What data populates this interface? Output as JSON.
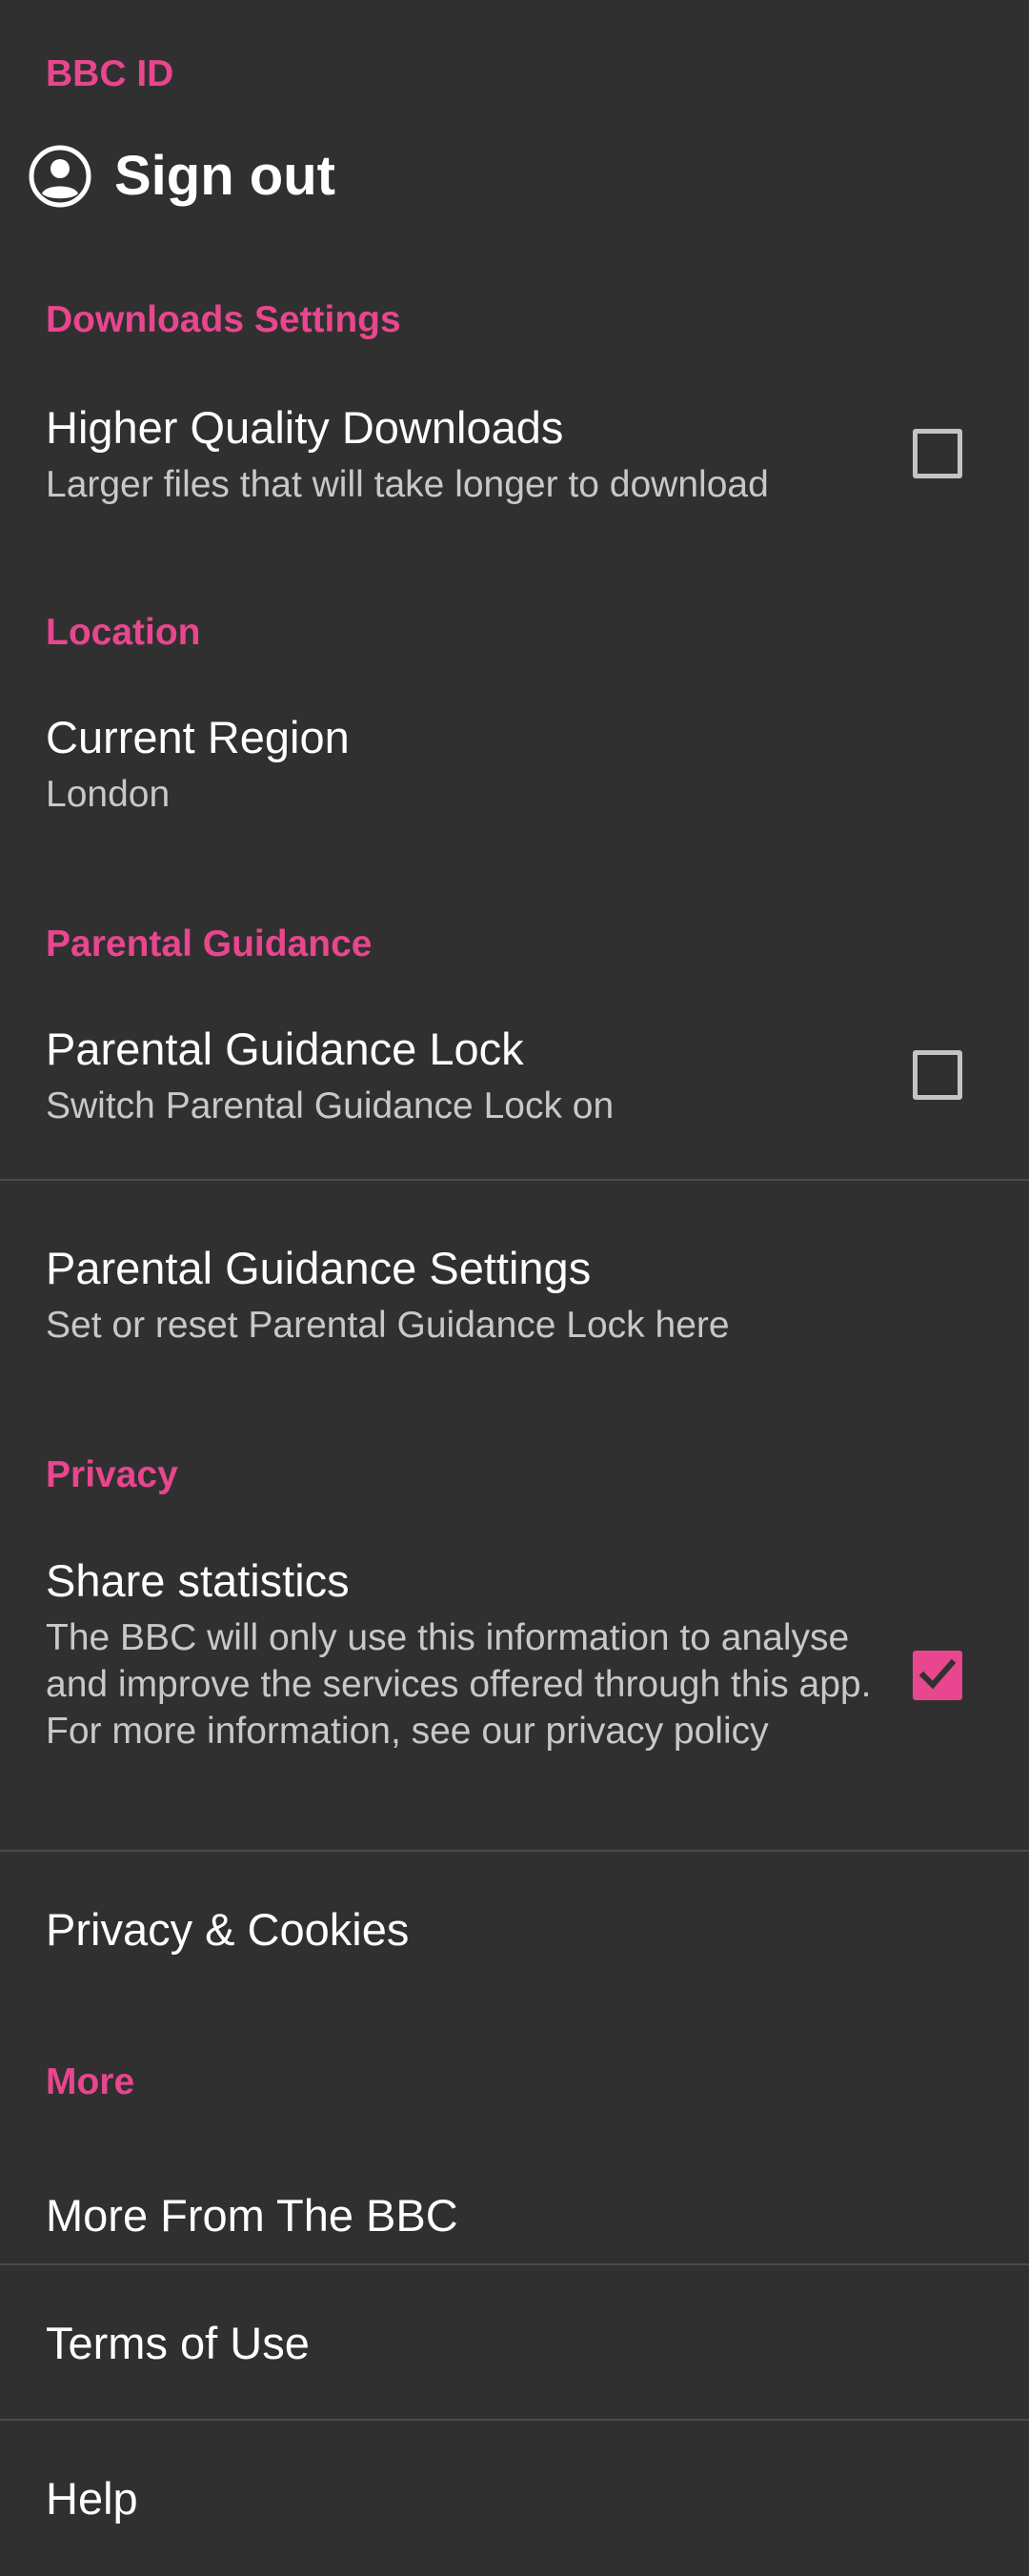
{
  "colors": {
    "background": "#303030",
    "accent": "#e8468e",
    "primary_text": "#ffffff",
    "secondary_text": "#c8c8c8",
    "divider": "#4a4a4a"
  },
  "bbc_id": {
    "header": "BBC ID",
    "sign_out": {
      "icon": "account-circle-icon",
      "label": "Sign out"
    }
  },
  "downloads": {
    "header": "Downloads Settings",
    "higher_quality": {
      "title": "Higher Quality Downloads",
      "summary": "Larger files that will take longer to download",
      "checked": false
    }
  },
  "location": {
    "header": "Location",
    "current_region": {
      "title": "Current Region",
      "summary": "London"
    }
  },
  "parental_guidance": {
    "header": "Parental Guidance",
    "lock": {
      "title": "Parental Guidance Lock",
      "summary": "Switch Parental Guidance Lock on",
      "checked": false
    },
    "settings": {
      "title": "Parental Guidance Settings",
      "summary": "Set or reset Parental Guidance Lock here"
    }
  },
  "privacy": {
    "header": "Privacy",
    "share_statistics": {
      "title": "Share statistics",
      "summary": "The BBC will only use this information to analyse and improve the services offered through this app. For more information, see our privacy policy",
      "checked": true
    },
    "privacy_cookies": {
      "title": "Privacy & Cookies"
    }
  },
  "more": {
    "header": "More",
    "more_from_bbc": "More From The BBC",
    "terms_of_use": "Terms of Use",
    "help": "Help"
  }
}
